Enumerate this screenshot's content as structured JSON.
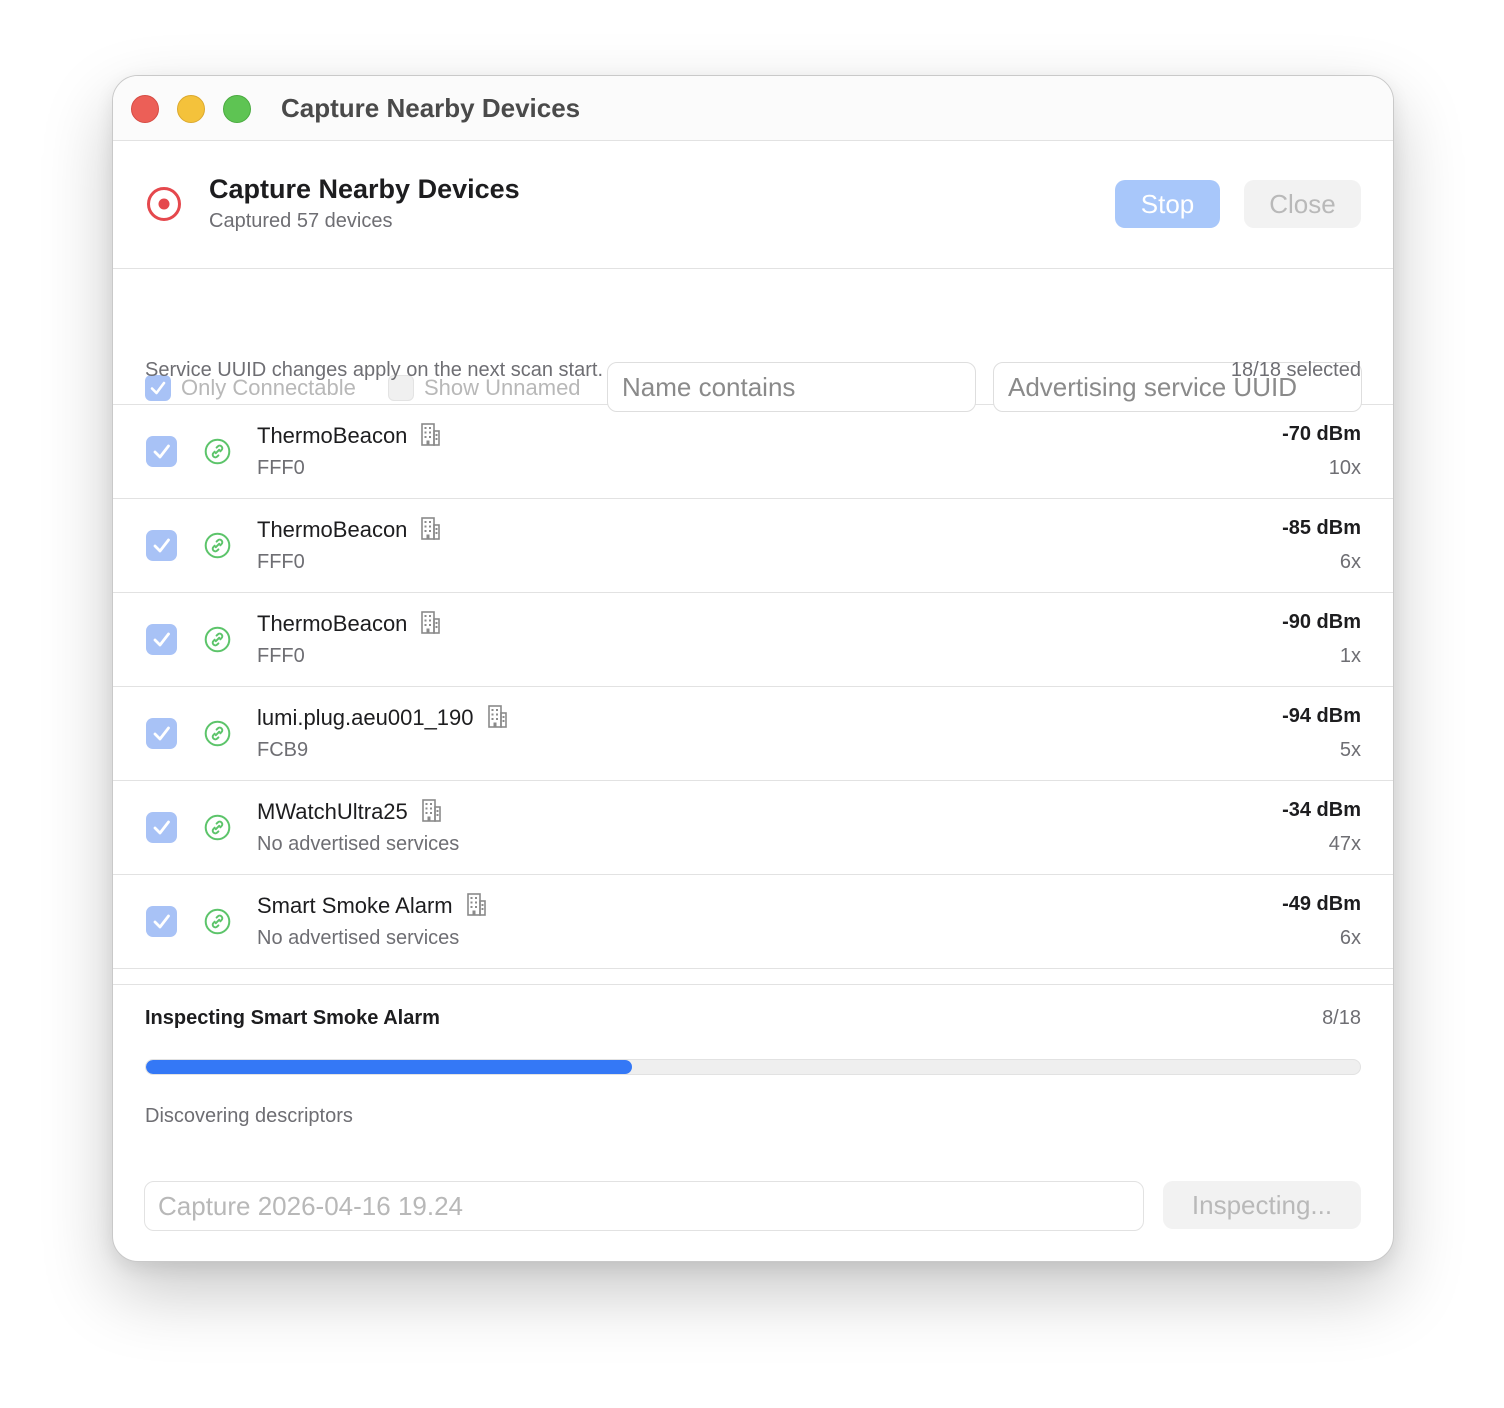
{
  "window": {
    "title": "Capture Nearby Devices"
  },
  "header": {
    "title": "Capture Nearby Devices",
    "subtitle": "Captured 57 devices",
    "stop_label": "Stop",
    "close_label": "Close"
  },
  "filters": {
    "only_connectable": {
      "label": "Only Connectable",
      "checked": true
    },
    "show_unnamed": {
      "label": "Show Unnamed",
      "checked": false
    },
    "name_placeholder": "Name contains",
    "uuid_placeholder": "Advertising service UUID",
    "hint": "Service UUID changes apply on the next scan start.",
    "selected_count": "18/18 selected"
  },
  "devices": [
    {
      "name": "ThermoBeacon",
      "services": "FFF0",
      "rssi": "-70 dBm",
      "times": "10x",
      "selected": true
    },
    {
      "name": "ThermoBeacon",
      "services": "FFF0",
      "rssi": "-85 dBm",
      "times": "6x",
      "selected": true
    },
    {
      "name": "ThermoBeacon",
      "services": "FFF0",
      "rssi": "-90 dBm",
      "times": "1x",
      "selected": true
    },
    {
      "name": "lumi.plug.aeu001_190",
      "services": "FCB9",
      "rssi": "-94 dBm",
      "times": "5x",
      "selected": true
    },
    {
      "name": "MWatchUltra25",
      "services": "No advertised services",
      "rssi": "-34 dBm",
      "times": "47x",
      "selected": true
    },
    {
      "name": "Smart Smoke Alarm",
      "services": "No advertised services",
      "rssi": "-49 dBm",
      "times": "6x",
      "selected": true
    }
  ],
  "inspection": {
    "title": "Inspecting Smart Smoke Alarm",
    "count": "8/18",
    "progress": 0.4,
    "status": "Discovering descriptors",
    "capture_name_placeholder": "Capture 2026-04-16 19.24",
    "button_label": "Inspecting..."
  },
  "colors": {
    "accent": "#3478f6",
    "record": "#e5484d",
    "connectable": "#5cc46a"
  }
}
